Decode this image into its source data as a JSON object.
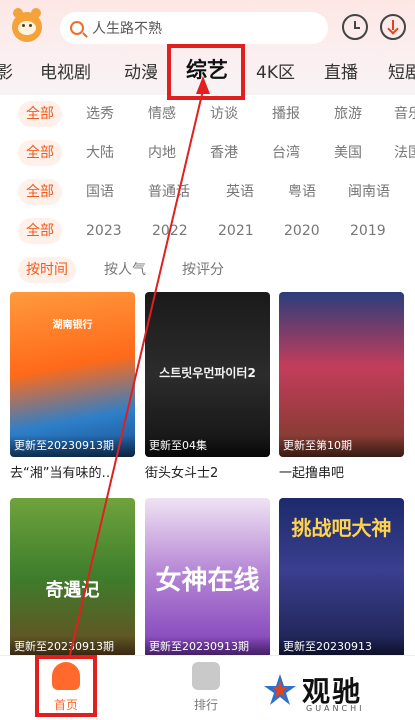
{
  "header": {
    "search_placeholder": "人生路不熟"
  },
  "tabs": [
    {
      "label": "影"
    },
    {
      "label": "电视剧"
    },
    {
      "label": "动漫"
    },
    {
      "label": "综艺"
    },
    {
      "label": "4K区"
    },
    {
      "label": "直播"
    },
    {
      "label": "短剧"
    }
  ],
  "filters": [
    [
      "全部",
      "选秀",
      "情感",
      "访谈",
      "播报",
      "旅游",
      "音乐"
    ],
    [
      "全部",
      "大陆",
      "内地",
      "香港",
      "台湾",
      "美国",
      "法国"
    ],
    [
      "全部",
      "国语",
      "普通话",
      "英语",
      "粤语",
      "闽南语"
    ],
    [
      "全部",
      "2023",
      "2022",
      "2021",
      "2020",
      "2019"
    ],
    [
      "按时间",
      "按人气",
      "按评分"
    ]
  ],
  "cards": [
    {
      "badge": "更新至20230913期",
      "title": "去“湘”当有味的…",
      "poster": "湖南银行"
    },
    {
      "badge": "更新至04集",
      "title": "街头女斗士2",
      "poster": "스트릿우먼파이터2"
    },
    {
      "badge": "更新至第10期",
      "title": "一起撸串吧",
      "poster": ""
    },
    {
      "badge": "更新至20230913期",
      "title": "",
      "poster": "奇遇记"
    },
    {
      "badge": "更新至20230913期",
      "title": "",
      "poster": "女神在线"
    },
    {
      "badge": "更新至20230913",
      "title": "",
      "poster": "挑战吧大神"
    }
  ],
  "bottom_nav": {
    "home": "首页",
    "rank": "排行"
  },
  "watermark": {
    "main": "观驰",
    "sub": "GUANCHI"
  },
  "colors": {
    "accent": "#f05a1e",
    "annotation": "#e11f1f"
  }
}
